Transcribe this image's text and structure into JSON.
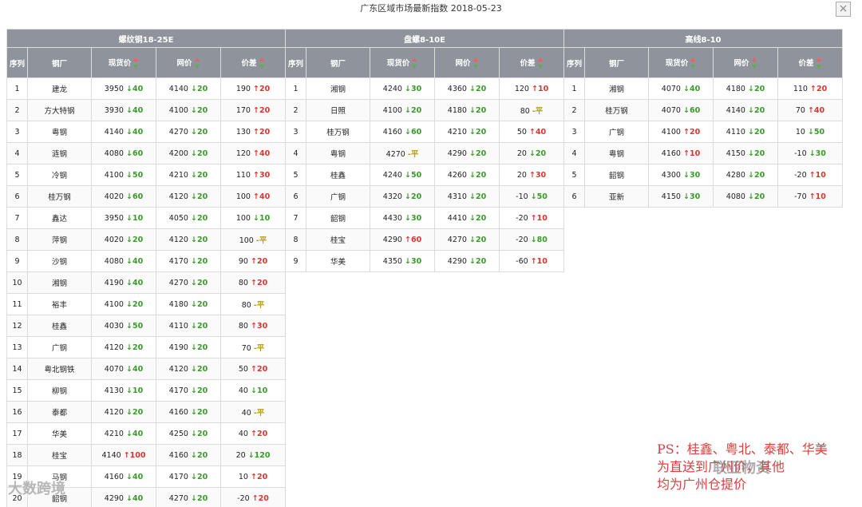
{
  "window": {
    "title": "广东区域市场最新指数 2018-05-23",
    "close_symbol": "×"
  },
  "columns": [
    "序列",
    "钢厂",
    "现货价",
    "网价",
    "价差"
  ],
  "tables": [
    {
      "name": "螺纹钢18-25E",
      "rows": [
        {
          "n": "1",
          "mill": "建龙",
          "spot": "3950",
          "spot_chg": "↓40",
          "net": "4140",
          "net_chg": "↓20",
          "diff": "190",
          "diff_chg": "↑20"
        },
        {
          "n": "2",
          "mill": "方大特钢",
          "spot": "3930",
          "spot_chg": "↓40",
          "net": "4100",
          "net_chg": "↓20",
          "diff": "170",
          "diff_chg": "↑20"
        },
        {
          "n": "3",
          "mill": "粤钢",
          "spot": "4140",
          "spot_chg": "↓40",
          "net": "4270",
          "net_chg": "↓20",
          "diff": "130",
          "diff_chg": "↑20"
        },
        {
          "n": "4",
          "mill": "涟钢",
          "spot": "4080",
          "spot_chg": "↓60",
          "net": "4200",
          "net_chg": "↓20",
          "diff": "120",
          "diff_chg": "↑40"
        },
        {
          "n": "5",
          "mill": "冷钢",
          "spot": "4100",
          "spot_chg": "↓50",
          "net": "4210",
          "net_chg": "↓20",
          "diff": "110",
          "diff_chg": "↑30"
        },
        {
          "n": "6",
          "mill": "桂万钢",
          "spot": "4020",
          "spot_chg": "↓60",
          "net": "4120",
          "net_chg": "↓20",
          "diff": "100",
          "diff_chg": "↑40"
        },
        {
          "n": "7",
          "mill": "鑫达",
          "spot": "3950",
          "spot_chg": "↓10",
          "net": "4050",
          "net_chg": "↓20",
          "diff": "100",
          "diff_chg": "↓10"
        },
        {
          "n": "8",
          "mill": "萍钢",
          "spot": "4020",
          "spot_chg": "↓20",
          "net": "4120",
          "net_chg": "↓20",
          "diff": "100",
          "diff_chg": "-平"
        },
        {
          "n": "9",
          "mill": "沙钢",
          "spot": "4080",
          "spot_chg": "↓40",
          "net": "4170",
          "net_chg": "↓20",
          "diff": "90",
          "diff_chg": "↑20"
        },
        {
          "n": "10",
          "mill": "湘钢",
          "spot": "4190",
          "spot_chg": "↓40",
          "net": "4270",
          "net_chg": "↓20",
          "diff": "80",
          "diff_chg": "↑20"
        },
        {
          "n": "11",
          "mill": "裕丰",
          "spot": "4100",
          "spot_chg": "↓20",
          "net": "4180",
          "net_chg": "↓20",
          "diff": "80",
          "diff_chg": "-平"
        },
        {
          "n": "12",
          "mill": "桂鑫",
          "spot": "4030",
          "spot_chg": "↓50",
          "net": "4110",
          "net_chg": "↓20",
          "diff": "80",
          "diff_chg": "↑30"
        },
        {
          "n": "13",
          "mill": "广钢",
          "spot": "4120",
          "spot_chg": "↓20",
          "net": "4190",
          "net_chg": "↓20",
          "diff": "70",
          "diff_chg": "-平"
        },
        {
          "n": "14",
          "mill": "粤北钢铁",
          "spot": "4070",
          "spot_chg": "↓40",
          "net": "4120",
          "net_chg": "↓20",
          "diff": "50",
          "diff_chg": "↑20"
        },
        {
          "n": "15",
          "mill": "柳钢",
          "spot": "4130",
          "spot_chg": "↓10",
          "net": "4170",
          "net_chg": "↓20",
          "diff": "40",
          "diff_chg": "↓10"
        },
        {
          "n": "16",
          "mill": "泰都",
          "spot": "4120",
          "spot_chg": "↓20",
          "net": "4160",
          "net_chg": "↓20",
          "diff": "40",
          "diff_chg": "-平"
        },
        {
          "n": "17",
          "mill": "华美",
          "spot": "4210",
          "spot_chg": "↓40",
          "net": "4250",
          "net_chg": "↓20",
          "diff": "40",
          "diff_chg": "↑20"
        },
        {
          "n": "18",
          "mill": "桂宝",
          "spot": "4140",
          "spot_chg": "↑100",
          "net": "4160",
          "net_chg": "↓20",
          "diff": "20",
          "diff_chg": "↓120"
        },
        {
          "n": "19",
          "mill": "马钢",
          "spot": "4160",
          "spot_chg": "↓40",
          "net": "4170",
          "net_chg": "↓20",
          "diff": "10",
          "diff_chg": "↑20"
        },
        {
          "n": "20",
          "mill": "韶钢",
          "spot": "4290",
          "spot_chg": "↓40",
          "net": "4270",
          "net_chg": "↓20",
          "diff": "-20",
          "diff_chg": "↑20"
        }
      ]
    },
    {
      "name": "盘螺8-10E",
      "rows": [
        {
          "n": "1",
          "mill": "湘钢",
          "spot": "4240",
          "spot_chg": "↓30",
          "net": "4360",
          "net_chg": "↓20",
          "diff": "120",
          "diff_chg": "↑10"
        },
        {
          "n": "2",
          "mill": "日照",
          "spot": "4100",
          "spot_chg": "↓20",
          "net": "4180",
          "net_chg": "↓20",
          "diff": "80",
          "diff_chg": "-平"
        },
        {
          "n": "3",
          "mill": "桂万钢",
          "spot": "4160",
          "spot_chg": "↓60",
          "net": "4210",
          "net_chg": "↓20",
          "diff": "50",
          "diff_chg": "↑40"
        },
        {
          "n": "4",
          "mill": "粤钢",
          "spot": "4270",
          "spot_chg": "-平",
          "net": "4290",
          "net_chg": "↓20",
          "diff": "20",
          "diff_chg": "↓20"
        },
        {
          "n": "5",
          "mill": "桂鑫",
          "spot": "4240",
          "spot_chg": "↓50",
          "net": "4260",
          "net_chg": "↓20",
          "diff": "20",
          "diff_chg": "↑30"
        },
        {
          "n": "6",
          "mill": "广钢",
          "spot": "4320",
          "spot_chg": "↓20",
          "net": "4310",
          "net_chg": "↓20",
          "diff": "-10",
          "diff_chg": "↓50"
        },
        {
          "n": "7",
          "mill": "韶钢",
          "spot": "4430",
          "spot_chg": "↓30",
          "net": "4410",
          "net_chg": "↓20",
          "diff": "-20",
          "diff_chg": "↑10"
        },
        {
          "n": "8",
          "mill": "桂宝",
          "spot": "4290",
          "spot_chg": "↑60",
          "net": "4270",
          "net_chg": "↓20",
          "diff": "-20",
          "diff_chg": "↓80"
        },
        {
          "n": "9",
          "mill": "华美",
          "spot": "4350",
          "spot_chg": "↓30",
          "net": "4290",
          "net_chg": "↓20",
          "diff": "-60",
          "diff_chg": "↑10"
        }
      ]
    },
    {
      "name": "高线8-10",
      "rows": [
        {
          "n": "1",
          "mill": "湘钢",
          "spot": "4070",
          "spot_chg": "↓40",
          "net": "4180",
          "net_chg": "↓20",
          "diff": "110",
          "diff_chg": "↑20"
        },
        {
          "n": "2",
          "mill": "桂万钢",
          "spot": "4070",
          "spot_chg": "↓60",
          "net": "4140",
          "net_chg": "↓20",
          "diff": "70",
          "diff_chg": "↑40"
        },
        {
          "n": "3",
          "mill": "广钢",
          "spot": "4100",
          "spot_chg": "↑20",
          "net": "4110",
          "net_chg": "↓20",
          "diff": "10",
          "diff_chg": "↓50"
        },
        {
          "n": "4",
          "mill": "粤钢",
          "spot": "4160",
          "spot_chg": "↑10",
          "net": "4150",
          "net_chg": "↓20",
          "diff": "-10",
          "diff_chg": "↓30"
        },
        {
          "n": "5",
          "mill": "韶钢",
          "spot": "4300",
          "spot_chg": "↓30",
          "net": "4280",
          "net_chg": "↓20",
          "diff": "-20",
          "diff_chg": "↑10"
        },
        {
          "n": "6",
          "mill": "亚新",
          "spot": "4150",
          "spot_chg": "↓30",
          "net": "4080",
          "net_chg": "↓20",
          "diff": "-70",
          "diff_chg": "↑10"
        }
      ]
    }
  ],
  "note": {
    "line1": "PS：桂鑫、粤北、泰都、华美",
    "line2": "为直送到广州价，其他",
    "line3": "均为广州仓提价"
  },
  "watermarks": {
    "left": "大数跨境",
    "right": "联亚物资"
  },
  "colors": {
    "up": "#d9362f",
    "down": "#3a9b2a",
    "flat": "#b79b10",
    "header_bg": "#8e939c",
    "note": "#d94040"
  }
}
